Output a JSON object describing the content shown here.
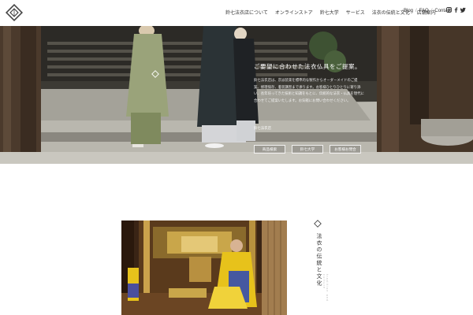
{
  "header": {
    "logo": "brand-diamond-logo",
    "nav": [
      "鈴七法衣店について",
      "オンラインストア",
      "鈴七大学",
      "サービス",
      "法衣の伝統と文化",
      "店舗案内"
    ],
    "utility": [
      "Blog",
      "FAQ",
      "Contact"
    ],
    "utility_separator": "/",
    "social_icons": [
      "instagram-icon",
      "facebook-icon",
      "twitter-icon"
    ]
  },
  "hero": {
    "heading": "ご要望に合わせた法衣仏具をご提案。",
    "body": "鈴七法衣店は、宗派装束を標準的な製作からオーダーメイドのご提案、修理保存、着装講習まで承ります。お客様ひとりひとりに寄り添い、長年培ってきた技術と知識をもとに、伝統的な法衣・仏具を現代に合わせてご提案いたします。お気軽にお問い合わせください。",
    "link": "鈴七法衣店",
    "buttons": [
      "商品検索",
      "鈴七大学",
      "お客様お問合"
    ]
  },
  "section": {
    "title": "法衣の伝統と文化",
    "subtitle": "tradition and culture"
  },
  "colors": {
    "accent_gold": "#c9a64a",
    "robe_yellow": "#e7c21b",
    "text": "#333333"
  }
}
